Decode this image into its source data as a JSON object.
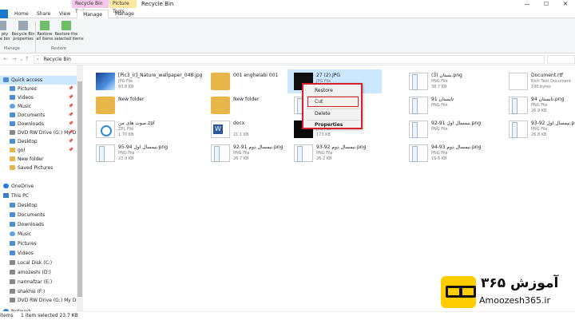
{
  "window": {
    "title": "Recycle Bin",
    "context_tab_recycle": "Recycle Bin Tools",
    "context_tab_picture": "Picture Tools",
    "minimize": "—",
    "maximize": "☐",
    "close": "✕"
  },
  "ribbon_tabs": {
    "home": "Home",
    "share": "Share",
    "view": "View",
    "manage": "Manage",
    "manage2": "Manage"
  },
  "ribbon": {
    "empty_label": "pty\ne bin",
    "properties_label": "Recycle Bin\nproperties",
    "restore_all_label": "Restore\nall items",
    "restore_selected_label": "Restore the\nselected items",
    "group_manage": "Manage",
    "group_restore": "Restore"
  },
  "address": {
    "back": "←",
    "forward": "→",
    "recent": "⌄",
    "up": "↑",
    "crumb_sep": "›",
    "path": "Recycle Bin"
  },
  "sidebar": {
    "items": [
      {
        "label": "Quick access",
        "icon": "star-icon",
        "pinned": false
      },
      {
        "label": "Pictures",
        "icon": "pictures-icon",
        "pinned": true
      },
      {
        "label": "Videos",
        "icon": "videos-icon",
        "pinned": true
      },
      {
        "label": "Music",
        "icon": "music-icon",
        "pinned": true
      },
      {
        "label": "Documents",
        "icon": "documents-icon",
        "pinned": true
      },
      {
        "label": "Downloads",
        "icon": "downloads-icon",
        "pinned": true
      },
      {
        "label": "DVD RW Drive (G:) My Disc",
        "icon": "dvd-drive-icon",
        "pinned": true
      },
      {
        "label": "Desktop",
        "icon": "desktop-icon",
        "pinned": true
      },
      {
        "label": "gol",
        "icon": "folder-icon",
        "pinned": true
      },
      {
        "label": "New folder",
        "icon": "folder-icon",
        "pinned": false
      },
      {
        "label": "Saved Pictures",
        "icon": "folder-icon",
        "pinned": false
      },
      {
        "label": "OneDrive",
        "icon": "onedrive-icon",
        "pinned": false
      },
      {
        "label": "This PC",
        "icon": "this-pc-icon",
        "pinned": false
      },
      {
        "label": "Desktop",
        "icon": "desktop-icon",
        "pinned": false
      },
      {
        "label": "Documents",
        "icon": "documents-icon",
        "pinned": false
      },
      {
        "label": "Downloads",
        "icon": "downloads-icon",
        "pinned": false
      },
      {
        "label": "Music",
        "icon": "music-icon",
        "pinned": false
      },
      {
        "label": "Pictures",
        "icon": "pictures-icon",
        "pinned": false
      },
      {
        "label": "Videos",
        "icon": "videos-icon",
        "pinned": false
      },
      {
        "label": "Local Disk (C:)",
        "icon": "local-disk-icon",
        "pinned": false
      },
      {
        "label": "amozeshi (D:)",
        "icon": "disk-icon",
        "pinned": false
      },
      {
        "label": "narmafzar (E:)",
        "icon": "disk-icon",
        "pinned": false
      },
      {
        "label": "shakhsi (F:)",
        "icon": "disk-icon",
        "pinned": false
      },
      {
        "label": "DVD RW Drive (G:) My Disc",
        "icon": "dvd-drive-icon",
        "pinned": false
      },
      {
        "label": "Network",
        "icon": "network-icon",
        "pinned": false
      }
    ],
    "pin_glyph": "📌"
  },
  "files": [
    {
      "name": "[Pic3_ir]_Nature_wallpaper_048.jpg",
      "type": "JPG File",
      "size": "93.8 KB",
      "thumb": "jpg-blue"
    },
    {
      "name": "001 enghelabi 001",
      "type": "",
      "size": "",
      "thumb": "folder"
    },
    {
      "name": "27 (2).JPG",
      "type": "JPG File",
      "size": "",
      "thumb": "jpg-dark"
    },
    {
      "name": "بستان (3).png",
      "type": "PNG File",
      "size": "38.7 KB",
      "thumb": "png"
    },
    {
      "name": "Document.rtf",
      "type": "Rich Text Document",
      "size": "196 bytes",
      "thumb": "rtf"
    },
    {
      "name": "New folder",
      "type": "",
      "size": "",
      "thumb": "folder"
    },
    {
      "name": "New folder",
      "type": "",
      "size": "",
      "thumb": "folder"
    },
    {
      "name": "Untitled.png",
      "type": "PNG File",
      "size": "22.2 KB",
      "thumb": "png"
    },
    {
      "name": "تابستان 91",
      "type": "PNG File",
      "size": "",
      "thumb": "png"
    },
    {
      "name": "تابستان 94.png",
      "type": "PNG File",
      "size": "26.9 KB",
      "thumb": "png"
    },
    {
      "name": "صوت های من.zpl",
      "type": "ZPL File",
      "size": "1.70 KB",
      "thumb": "zpl"
    },
    {
      "name": "docx",
      "type": "",
      "size": "21.1 KB",
      "thumb": "word"
    },
    {
      "name": "عاشقانه.jpg",
      "type": "JPG File",
      "size": "173 KB",
      "thumb": "jpg-dark2"
    },
    {
      "name": "نیمسال اول 91-92.png",
      "type": "PNG File",
      "size": "",
      "thumb": "png"
    },
    {
      "name": "نیمسال اول 92-93.png",
      "type": "PNG File",
      "size": "26.8 KB",
      "thumb": "png"
    },
    {
      "name": "نیمسال اول 94-95.png",
      "type": "PNG File",
      "size": "23.9 KB",
      "thumb": "png"
    },
    {
      "name": "نیمسال دوم 91-92.png",
      "type": "PNG File",
      "size": "26.7 KB",
      "thumb": "png"
    },
    {
      "name": "نیمسال دوم 92-93.png",
      "type": "PNG File",
      "size": "26.2 KB",
      "thumb": "png"
    },
    {
      "name": "نیمسال دوم 93-94.png",
      "type": "PNG File",
      "size": "19.6 KB",
      "thumb": "png"
    }
  ],
  "context_menu": {
    "restore": "Restore",
    "cut": "Cut",
    "delete": "Delete",
    "properties": "Properties"
  },
  "status": {
    "items": "items",
    "selected": "1 item selected  23.7 KB"
  },
  "logo": {
    "text_fa": "آموزش ۳۶۵",
    "text_en": "Amoozesh365.ir"
  },
  "colors": {
    "accent": "#1979ca",
    "selection": "#cce8ff",
    "highlight_box": "#d6202d",
    "logo_yellow": "#ffcc00"
  }
}
